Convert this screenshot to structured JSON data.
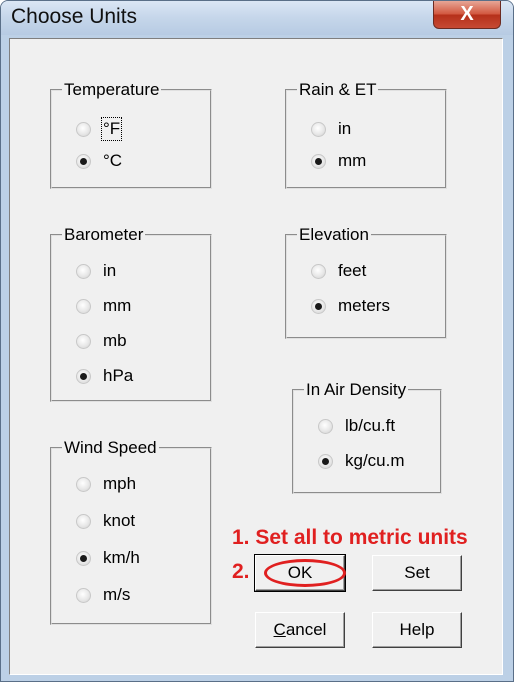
{
  "window": {
    "title": "Choose Units",
    "close_label": "X"
  },
  "temperature": {
    "label": "Temperature",
    "options": [
      "°F",
      "°C"
    ],
    "selected": "°C"
  },
  "rain": {
    "label": "Rain & ET",
    "options": [
      "in",
      "mm"
    ],
    "selected": "mm"
  },
  "barometer": {
    "label": "Barometer",
    "options": [
      "in",
      "mm",
      "mb",
      "hPa"
    ],
    "selected": "hPa"
  },
  "elevation": {
    "label": "Elevation",
    "options": [
      "feet",
      "meters"
    ],
    "selected": "meters"
  },
  "air_density": {
    "label": "In Air Density",
    "options": [
      "lb/cu.ft",
      "kg/cu.m"
    ],
    "selected": "kg/cu.m"
  },
  "wind": {
    "label": "Wind Speed",
    "options": [
      "mph",
      "knot",
      "km/h",
      "m/s"
    ],
    "selected": "km/h"
  },
  "buttons": {
    "ok": "OK",
    "set": "Set",
    "cancel": "Cancel",
    "help": "Help"
  },
  "annotations": {
    "step1": "1. Set all to metric units",
    "step2": "2."
  },
  "colors": {
    "annotation": "#e02020",
    "titlebar": "#c5d6ea",
    "close": "#c64a34"
  }
}
